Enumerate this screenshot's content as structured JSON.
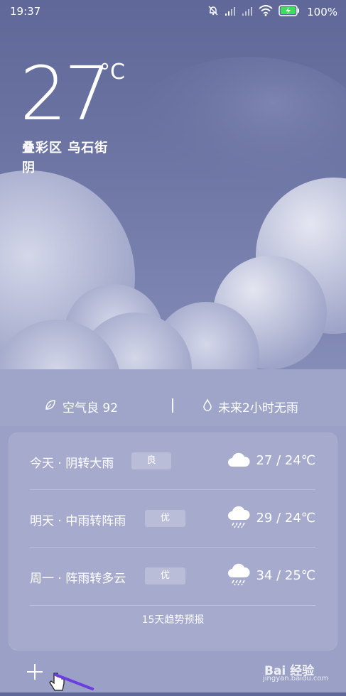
{
  "status_bar": {
    "time": "19:37",
    "battery_percent": "100%",
    "icons": [
      "mute-bell-icon",
      "signal-icon",
      "signal-icon",
      "wifi-icon",
      "battery-charging-icon"
    ]
  },
  "current": {
    "temperature": "27",
    "unit": "°C",
    "location": "叠彩区 乌石街",
    "condition": "阴"
  },
  "info": {
    "air_quality": "空气良 92",
    "rain_forecast": "未来2小时无雨",
    "icons": [
      "leaf-icon",
      "droplet-icon"
    ]
  },
  "forecast": {
    "days": [
      {
        "label": "今天 · 阴转大雨",
        "aqi": "良",
        "icon": "cloud-icon",
        "range": "27 / 24℃"
      },
      {
        "label": "明天 · 中雨转阵雨",
        "aqi": "优",
        "icon": "rain-cloud-icon",
        "range": "29 / 24℃"
      },
      {
        "label": "周一 · 阵雨转多云",
        "aqi": "优",
        "icon": "rain-cloud-icon",
        "range": "34 / 25℃"
      }
    ],
    "trend_link": "15天趋势预报"
  },
  "bottom": {
    "add_icon": "plus-icon",
    "watermark_text": "Bai 经验",
    "watermark_sub": "jingyan.baidu.com"
  },
  "colors": {
    "sky_top": "#5f6898",
    "sky_bottom": "#a7aed2",
    "cloud": "#c9cde2"
  }
}
